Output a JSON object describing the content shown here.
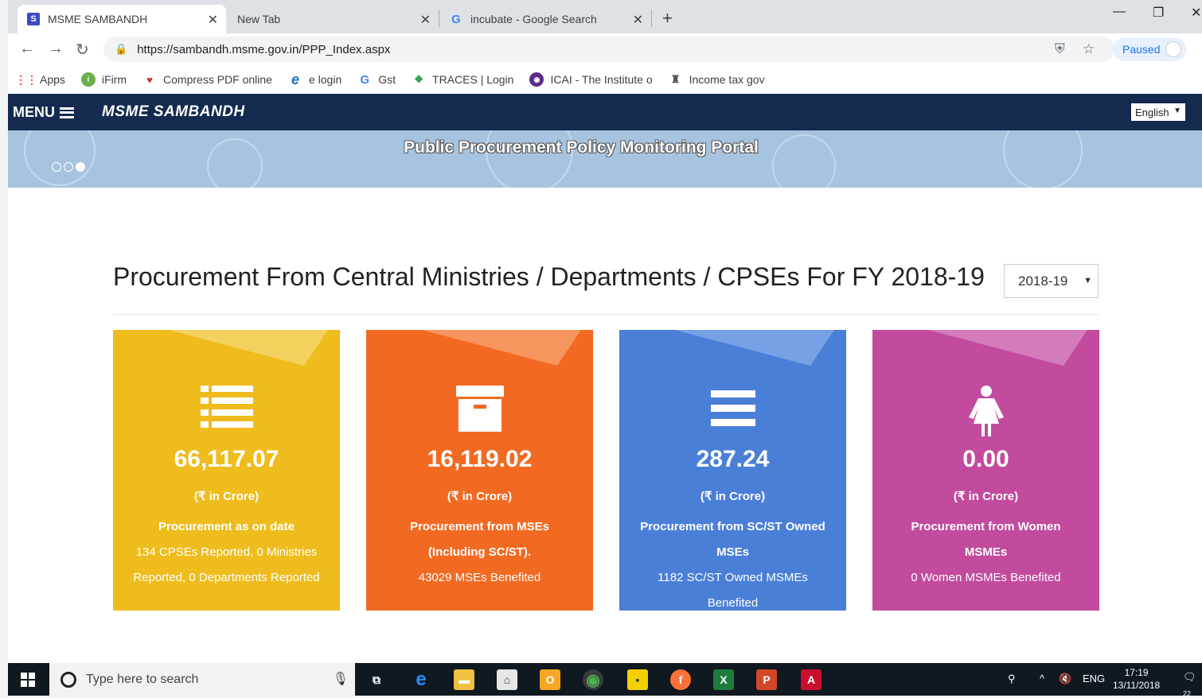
{
  "browser": {
    "tabs": [
      {
        "label": "MSME SAMBANDH",
        "active": true,
        "favicon": "S"
      },
      {
        "label": "New Tab",
        "active": false
      },
      {
        "label": "incubate - Google Search",
        "active": false,
        "favicon": "G"
      }
    ],
    "url": "https://sambandh.msme.gov.in/PPP_Index.aspx",
    "profile_status": "Paused",
    "bookmarks": [
      {
        "label": "Apps",
        "icon": "apps-grid-icon"
      },
      {
        "label": "iFirm",
        "icon": "ifirm-icon"
      },
      {
        "label": "Compress PDF online",
        "icon": "heart-icon"
      },
      {
        "label": "e login",
        "icon": "ie-icon"
      },
      {
        "label": "Gst",
        "icon": "google-icon"
      },
      {
        "label": "TRACES | Login",
        "icon": "traces-icon"
      },
      {
        "label": "ICAI - The Institute o",
        "icon": "icai-icon"
      },
      {
        "label": "Income tax gov",
        "icon": "emblem-icon"
      }
    ]
  },
  "site": {
    "menu_label": "MENU",
    "title": "MSME SAMBANDH",
    "language": "English",
    "banner_text": "Public Procurement Policy Monitoring Portal",
    "page_title": "Procurement From Central Ministries / Departments / CPSEs For FY 2018-19",
    "fy_selected": "2018-19"
  },
  "cards": [
    {
      "amount": "66,117.07",
      "unit": "(₹ in Crore)",
      "title": "Procurement as on date",
      "desc": "134 CPSEs Reported, 0 Ministries Reported, 0 Departments Reported",
      "color": "#eebc1d",
      "fold": "#f4d15f",
      "icon": "list-icon"
    },
    {
      "amount": "16,119.02",
      "unit": "(₹ in Crore)",
      "title": "Procurement from MSEs (Including SC/ST).",
      "desc": "43029 MSEs Benefited",
      "color": "#f26a22",
      "fold": "#f7955e",
      "icon": "archive-icon"
    },
    {
      "amount": "287.24",
      "unit": "(₹ in Crore)",
      "title": "Procurement from SC/ST Owned MSEs",
      "desc": "1182 SC/ST Owned MSMEs Benefited",
      "color": "#4a7fd8",
      "fold": "#77a1e5",
      "icon": "menu-bars-icon"
    },
    {
      "amount": "0.00",
      "unit": "(₹ in Crore)",
      "title": "Procurement from Women MSMEs",
      "desc": "0 Women MSMEs Benefited",
      "color": "#c24b9e",
      "fold": "#d47bbb",
      "icon": "female-icon"
    }
  ],
  "taskbar": {
    "search_placeholder": "Type here to search",
    "language": "ENG",
    "time": "17:19",
    "date": "13/11/2018",
    "notification_count": "22"
  }
}
